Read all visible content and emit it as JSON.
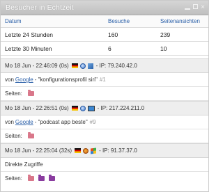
{
  "widget": {
    "title": "Besucher in Echtzeit",
    "controls": {
      "minimize": "minimize",
      "restore": "restore",
      "close": "×"
    }
  },
  "stats": {
    "headers": [
      "Datum",
      "Besuche",
      "Seitenansichten"
    ],
    "rows": [
      [
        "Letzte 24 Stunden",
        "160",
        "239"
      ],
      [
        "Letzte 30 Minuten",
        "6",
        "10"
      ]
    ]
  },
  "visits": [
    {
      "timestamp": "Mo 18 Jun - 22:46:09 (0s)",
      "icons": [
        "flag-de-icon",
        "browser-icon",
        "os-icon"
      ],
      "ip": "- IP: 79.240.42.0",
      "referrer_prefix": "von",
      "referrer_link": "Google",
      "referrer_query": "- \"konfigurationsprofil siri\"",
      "rank": "#1",
      "pages_label": "Seiten:",
      "pages": [
        "pink"
      ]
    },
    {
      "timestamp": "Mo 18 Jun - 22:26:51 (0s)",
      "icons": [
        "flag-de-icon",
        "browser-icon",
        "screen-icon"
      ],
      "ip": "- IP: 217.224.211.0",
      "referrer_prefix": "von",
      "referrer_link": "Google",
      "referrer_query": "- \"podcast app beste\"",
      "rank": "#9",
      "pages_label": "Seiten:",
      "pages": [
        "pink"
      ]
    },
    {
      "timestamp": "Mo 18 Jun - 22:25:04 (32s)",
      "icons": [
        "flag-de-icon",
        "firefox-icon",
        "windows-icon"
      ],
      "ip": "- IP: 91.37.37.0",
      "referrer_text": "Direkte Zugriffe",
      "pages_label": "Seiten:",
      "pages": [
        "pink",
        "purple",
        "purple"
      ]
    }
  ]
}
